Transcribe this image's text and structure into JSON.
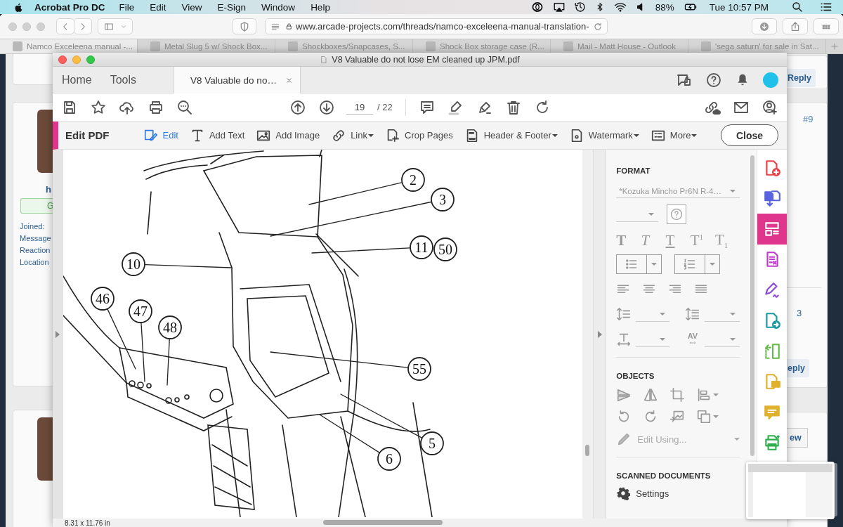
{
  "menu_bar": {
    "app_name": "Acrobat Pro DC",
    "menus": [
      "File",
      "Edit",
      "View",
      "E-Sign",
      "Window",
      "Help"
    ],
    "battery": "88%",
    "clock": "Tue 10:57 PM"
  },
  "browser": {
    "url": "www.arcade-projects.com/threads/namco-exceleena-manual-translation-",
    "tabs": [
      {
        "title": "Namco Exceleena manual -...",
        "selected": true
      },
      {
        "title": "Metal Slug 5 w/ Shock Box...",
        "selected": false
      },
      {
        "title": "Shockboxes/Snapcases, S...",
        "selected": false
      },
      {
        "title": "Shock Box storage case (R...",
        "selected": false
      },
      {
        "title": "Mail - Matt House - Outlook",
        "selected": false
      },
      {
        "title": "'sega saturn' for sale in Sat...",
        "selected": false
      }
    ],
    "forum": {
      "username": "h",
      "badge": "G",
      "stats": [
        "Joined:",
        "Message",
        "Reaction",
        "Location"
      ],
      "reply_top": "Reply",
      "post_number": "#9",
      "fragment": "3",
      "reply_bottom": "eply",
      "button_bottom": "ew"
    }
  },
  "acrobat": {
    "title": "V8 Valuable do not lose EM cleaned up JPM.pdf",
    "tabs": [
      {
        "label": "Home",
        "selected": false
      },
      {
        "label": "Tools",
        "selected": false
      },
      {
        "label": "V8 Valuable do no…",
        "selected": true
      }
    ],
    "page": "19",
    "page_count": "/ 22",
    "edit_bar": {
      "title": "Edit PDF",
      "tools": [
        {
          "kind": "edit",
          "label": "Edit",
          "selected": true,
          "dropdown": false
        },
        {
          "kind": "text",
          "label": "Add Text",
          "selected": false,
          "dropdown": false
        },
        {
          "kind": "image",
          "label": "Add Image",
          "selected": false,
          "dropdown": false
        },
        {
          "kind": "link",
          "label": "Link",
          "selected": false,
          "dropdown": true
        },
        {
          "kind": "crop",
          "label": "Crop Pages",
          "selected": false,
          "dropdown": false
        },
        {
          "kind": "header",
          "label": "Header & Footer",
          "selected": false,
          "dropdown": true
        },
        {
          "kind": "watermark",
          "label": "Watermark",
          "selected": false,
          "dropdown": true
        },
        {
          "kind": "more",
          "label": "More",
          "selected": false,
          "dropdown": true
        }
      ],
      "close": "Close"
    },
    "callouts": [
      "2",
      "3",
      "11",
      "50",
      "10",
      "46",
      "47",
      "48",
      "55",
      "5",
      "6"
    ],
    "panel": {
      "format_heading": "FORMAT",
      "font": "*Kozuka Mincho Pr6N R-4…",
      "text_styles": [
        {
          "kind": "bold",
          "label": "T"
        },
        {
          "kind": "italic",
          "label": "T"
        },
        {
          "kind": "underline",
          "label": "T"
        },
        {
          "kind": "superscript",
          "label": "T$^{1}$"
        },
        {
          "kind": "subscript",
          "label": "T$_{1}$"
        }
      ],
      "kerning_label": "AV",
      "objects_heading": "OBJECTS",
      "edit_using": "Edit Using...",
      "scanned_heading": "SCANNED DOCUMENTS",
      "settings": "Settings"
    },
    "tool_strip": [
      {
        "kind": "create",
        "color": "#e5434b",
        "selected": false
      },
      {
        "kind": "combine",
        "color": "#5a63de",
        "selected": false
      },
      {
        "kind": "organize",
        "color": "#e0358d",
        "selected": true
      },
      {
        "kind": "form",
        "color": "#c23ad0",
        "selected": false
      },
      {
        "kind": "sign",
        "color": "#8a4ad6",
        "selected": false
      },
      {
        "kind": "export",
        "color": "#1a9aa0",
        "selected": false
      },
      {
        "kind": "compare",
        "color": "#62bb46",
        "selected": false
      },
      {
        "kind": "review",
        "color": "#e0b12c",
        "selected": false
      },
      {
        "kind": "comment",
        "color": "#e0b12c",
        "selected": false
      },
      {
        "kind": "print",
        "color": "#2fae4e",
        "selected": false
      }
    ],
    "page_size": "8.31 x 11.76 in"
  }
}
